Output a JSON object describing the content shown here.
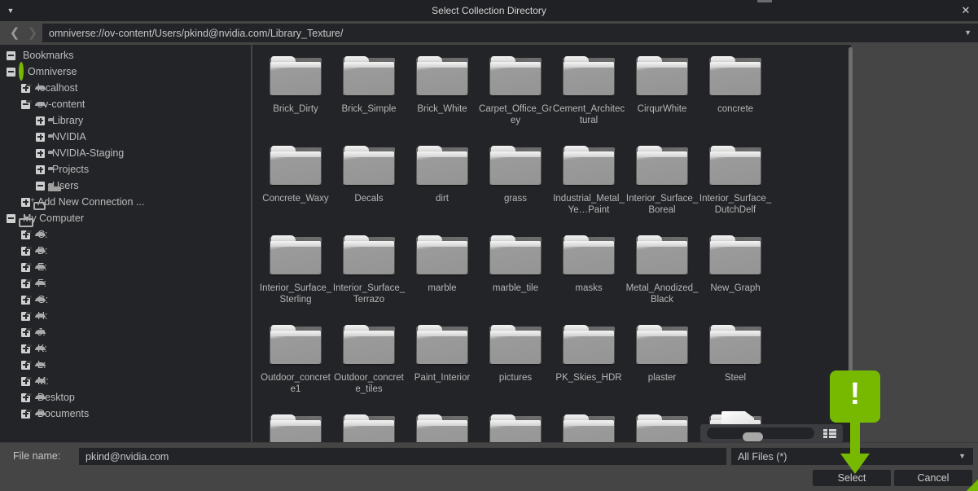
{
  "window": {
    "title": "Select Collection Directory",
    "menu_icon": "caret-down-icon",
    "close_icon": "close-icon"
  },
  "pathbar": {
    "back_icon": "chevron-left-icon",
    "forward_icon": "chevron-right-icon",
    "path": "omniverse://ov-content/Users/pkind@nvidia.com/Library_Texture/",
    "dropdown_icon": "caret-down-icon"
  },
  "sidebar": {
    "items": [
      {
        "label": "Bookmarks",
        "indent": 0,
        "expander": "minus",
        "icon": "bookmark-icon"
      },
      {
        "label": "Omniverse",
        "indent": 0,
        "expander": "minus",
        "icon": "omniverse-icon"
      },
      {
        "label": "localhost",
        "indent": 1,
        "expander": "plus",
        "icon": "server-icon"
      },
      {
        "label": "ov-content",
        "indent": 1,
        "expander": "minus",
        "icon": "server-icon"
      },
      {
        "label": "Library",
        "indent": 2,
        "expander": "plus",
        "icon": "folder-icon"
      },
      {
        "label": "NVIDIA",
        "indent": 2,
        "expander": "plus",
        "icon": "folder-icon"
      },
      {
        "label": "NVIDIA-Staging",
        "indent": 2,
        "expander": "plus",
        "icon": "folder-icon"
      },
      {
        "label": "Projects",
        "indent": 2,
        "expander": "plus",
        "icon": "folder-icon"
      },
      {
        "label": "Users",
        "indent": 2,
        "expander": "minus",
        "icon": "folder-open-icon"
      },
      {
        "label": "Add New Connection ...",
        "indent": 1,
        "expander": "plus",
        "icon": "add-connection-icon"
      },
      {
        "label": "My Computer",
        "indent": 0,
        "expander": "minus",
        "icon": "monitor-icon"
      },
      {
        "label": "C:",
        "indent": 1,
        "expander": "plus",
        "icon": "drive-icon"
      },
      {
        "label": "D:",
        "indent": 1,
        "expander": "plus",
        "icon": "drive-icon"
      },
      {
        "label": "E:",
        "indent": 1,
        "expander": "plus",
        "icon": "drive-icon"
      },
      {
        "label": "F:",
        "indent": 1,
        "expander": "plus",
        "icon": "drive-icon"
      },
      {
        "label": "G:",
        "indent": 1,
        "expander": "plus",
        "icon": "drive-icon"
      },
      {
        "label": "H:",
        "indent": 1,
        "expander": "plus",
        "icon": "drive-icon"
      },
      {
        "label": "J:",
        "indent": 1,
        "expander": "plus",
        "icon": "drive-icon"
      },
      {
        "label": "K:",
        "indent": 1,
        "expander": "plus",
        "icon": "drive-icon"
      },
      {
        "label": "L:",
        "indent": 1,
        "expander": "plus",
        "icon": "drive-icon"
      },
      {
        "label": "M:",
        "indent": 1,
        "expander": "plus",
        "icon": "drive-icon"
      },
      {
        "label": "Desktop",
        "indent": 1,
        "expander": "plus",
        "icon": "drive-icon"
      },
      {
        "label": "Documents",
        "indent": 1,
        "expander": "plus",
        "icon": "drive-icon"
      }
    ]
  },
  "grid": {
    "item_icon": "folder-icon",
    "items": [
      "Brick_Dirty",
      "Brick_Simple",
      "Brick_White",
      "Carpet_Office_Grey",
      "Cement_Architectural",
      "CirqurWhite",
      "concrete",
      "Concrete_Waxy",
      "Decals",
      "dirt",
      "grass",
      "Industrial_Metal_Ye…Paint",
      "Interior_Surface_Boreal",
      "Interior_Surface_DutchDelf",
      "Interior_Surface_Sterling",
      "Interior_Surface_Terrazo",
      "marble",
      "marble_tile",
      "masks",
      "Metal_Anodized_Black",
      "New_Graph",
      "Outdoor_concrete1",
      "Outdoor_concrete_tiles",
      "Paint_Interior",
      "pictures",
      "PK_Skies_HDR",
      "plaster",
      "Steel"
    ],
    "partial_row_count": 7,
    "image_file_icon": "image-file-icon"
  },
  "viewcontrols": {
    "zoom_slider": "thumbnail-size-slider",
    "list_view_icon": "list-view-icon"
  },
  "bottom": {
    "filename_label": "File name:",
    "filename_value": "pkind@nvidia.com",
    "filter_value": "All Files (*)",
    "filter_caret": "caret-down-icon",
    "select_label": "Select",
    "cancel_label": "Cancel"
  },
  "callout": {
    "glyph": "!",
    "color": "#76b900",
    "points_to": "Select"
  }
}
